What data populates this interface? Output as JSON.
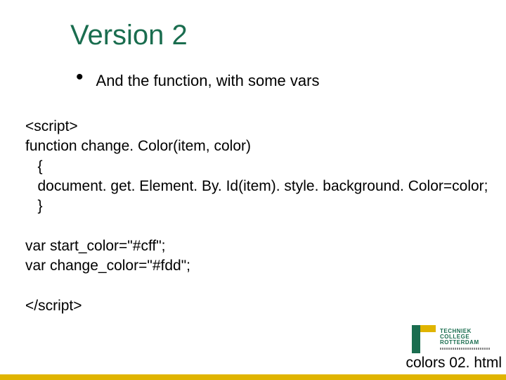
{
  "title": "Version 2",
  "bullet": "And the function, with some vars",
  "code": {
    "l1": "<script>",
    "l2": "function change. Color(item, color)",
    "l3": "   {",
    "l4": "   document. get. Element. By. Id(item). style. background. Color=color;",
    "l5": "   }",
    "l6": "",
    "l7": "var start_color=\"#cff\";",
    "l8": "var change_color=\"#fdd\";",
    "l9": "",
    "l10": "</script>"
  },
  "logo": {
    "line1": "TECHNIEK",
    "line2": "COLLEGE",
    "line3": "ROTTERDAM"
  },
  "caption": "colors 02. html"
}
